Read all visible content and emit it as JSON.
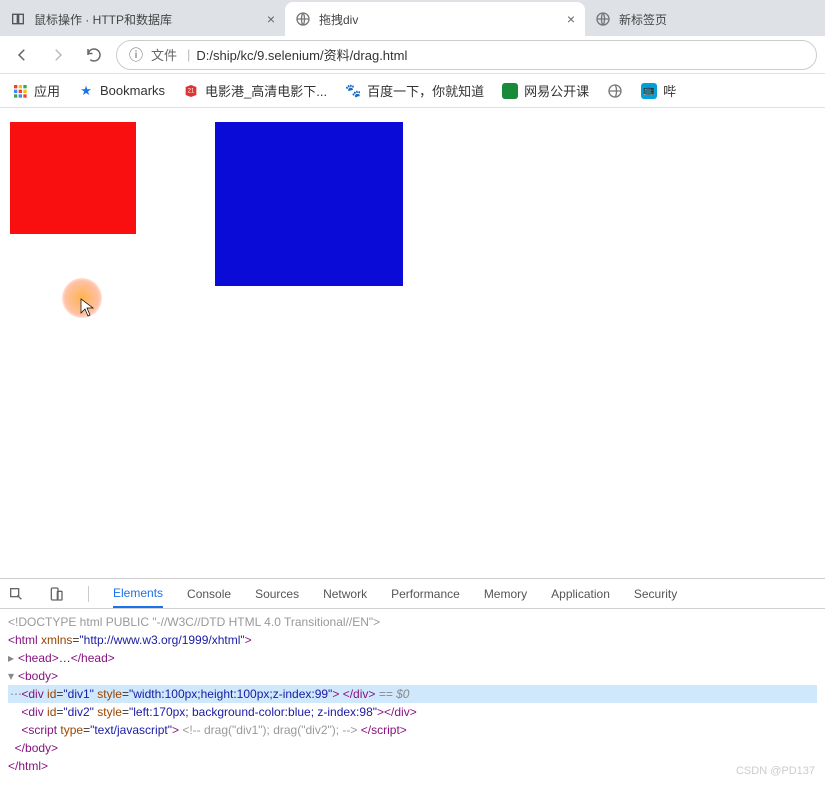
{
  "tabs": [
    {
      "title": "鼠标操作 · HTTP和数据库",
      "active": false,
      "close": true,
      "icon": "book-icon"
    },
    {
      "title": "拖拽div",
      "active": true,
      "close": true,
      "icon": "globe-icon"
    },
    {
      "title": "新标签页",
      "active": false,
      "close": false,
      "icon": "globe-icon"
    }
  ],
  "addr": {
    "scheme_label": "文件",
    "url": "D:/ship/kc/9.selenium/资料/drag.html"
  },
  "bookmarks": [
    {
      "label": "应用",
      "icon": "apps-icon"
    },
    {
      "label": "Bookmarks",
      "icon": "star-icon"
    },
    {
      "label": "电影港_高清电影下...",
      "icon": "movie-icon"
    },
    {
      "label": "百度一下，你就知道",
      "icon": "paw-icon"
    },
    {
      "label": "网易公开课",
      "icon": "green-icon"
    },
    {
      "label": "",
      "icon": "globe-gray-icon"
    },
    {
      "label": "哔",
      "icon": "tv-icon"
    }
  ],
  "devtools": {
    "tabs": [
      "Elements",
      "Console",
      "Sources",
      "Network",
      "Performance",
      "Memory",
      "Application",
      "Security"
    ],
    "active_tab": "Elements",
    "lines": {
      "doctype": "<!DOCTYPE html PUBLIC \"-//W3C//DTD HTML 4.0 Transitional//EN\">",
      "html_open": {
        "tag": "html",
        "attr": "xmlns",
        "val": "http://www.w3.org/1999/xhtml"
      },
      "head": {
        "open": "<head>",
        "dots": "…",
        "close": "</head>"
      },
      "body_open": "<body>",
      "div1": {
        "tag": "div",
        "attrs": [
          [
            "id",
            "div1"
          ],
          [
            "style",
            "width:100px;height:100px;z-index:99"
          ]
        ],
        "suffix": " == $0"
      },
      "div2": {
        "tag": "div",
        "attrs": [
          [
            "id",
            "div2"
          ],
          [
            "style",
            "left:170px; background-color:blue; z-index:98"
          ]
        ]
      },
      "script": {
        "tag": "script",
        "attrs": [
          [
            "type",
            "text/javascript"
          ]
        ],
        "comment": "<!-- drag(\"div1\"); drag(\"div2\"); -->"
      },
      "body_close": "</body>",
      "html_close": "</html>"
    }
  },
  "watermark": "CSDN @PD137"
}
